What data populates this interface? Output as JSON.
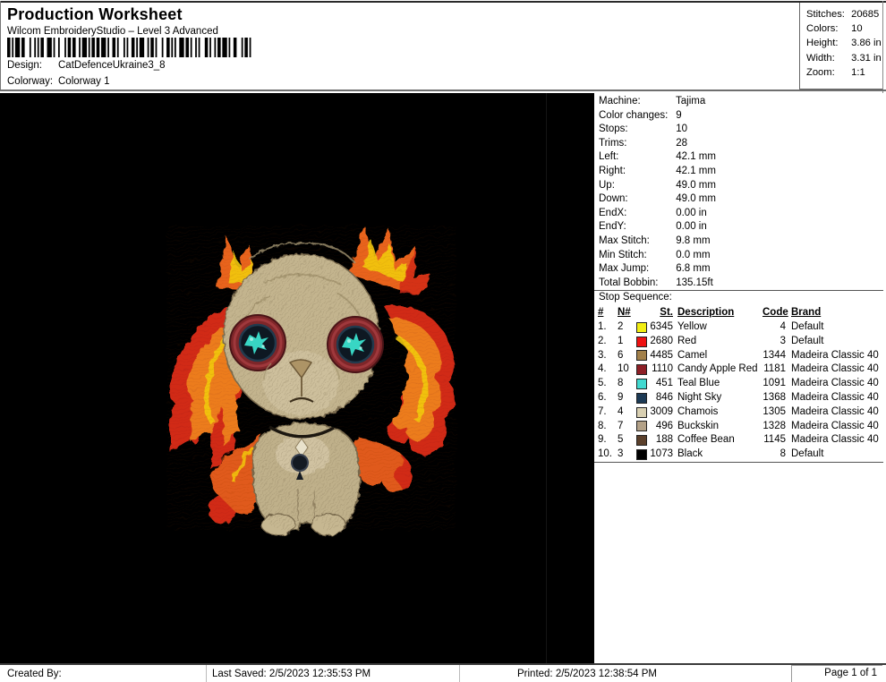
{
  "header": {
    "title": "Production Worksheet",
    "subtitle": "Wilcom EmbroideryStudio – Level 3 Advanced",
    "design_label": "Design:",
    "design_value": "CatDefenceUkraine3_8",
    "colorway_label": "Colorway:",
    "colorway_value": "Colorway 1"
  },
  "summary": {
    "rows": [
      {
        "label": "Stitches:",
        "value": "20685"
      },
      {
        "label": "Colors:",
        "value": "10"
      },
      {
        "label": "Height:",
        "value": "3.86 in"
      },
      {
        "label": "Width:",
        "value": "3.31 in"
      },
      {
        "label": "Zoom:",
        "value": "1:1"
      }
    ]
  },
  "machine_info": {
    "rows": [
      {
        "label": "Machine:",
        "value": "Tajima"
      },
      {
        "label": "Color changes:",
        "value": "9"
      },
      {
        "label": "Stops:",
        "value": "10"
      },
      {
        "label": "Trims:",
        "value": "28"
      },
      {
        "label": "Left:",
        "value": "42.1 mm"
      },
      {
        "label": "Right:",
        "value": "42.1 mm"
      },
      {
        "label": "Up:",
        "value": "49.0 mm"
      },
      {
        "label": "Down:",
        "value": "49.0 mm"
      },
      {
        "label": "EndX:",
        "value": "0.00 in"
      },
      {
        "label": "EndY:",
        "value": "0.00 in"
      },
      {
        "label": "Max Stitch:",
        "value": "9.8 mm"
      },
      {
        "label": "Min Stitch:",
        "value": "0.0 mm"
      },
      {
        "label": "Max Jump:",
        "value": "6.8 mm"
      },
      {
        "label": "Total Bobbin:",
        "value": "135.15ft"
      }
    ]
  },
  "stop_sequence": {
    "section_label": "Stop Sequence:",
    "columns": [
      "#",
      "N#",
      "St.",
      "Description",
      "Code",
      "Brand"
    ],
    "rows": [
      {
        "num": "1.",
        "n": "2",
        "swatch": "#f2ee12",
        "st": "6345",
        "description": "Yellow",
        "code": "4",
        "brand": "Default"
      },
      {
        "num": "2.",
        "n": "1",
        "swatch": "#ee1111",
        "st": "2680",
        "description": "Red",
        "code": "3",
        "brand": "Default"
      },
      {
        "num": "3.",
        "n": "6",
        "swatch": "#a28049",
        "st": "4485",
        "description": "Camel",
        "code": "1344",
        "brand": "Madeira Classic 40"
      },
      {
        "num": "4.",
        "n": "10",
        "swatch": "#8e1f26",
        "st": "1110",
        "description": "Candy Apple Red",
        "code": "1181",
        "brand": "Madeira Classic 40"
      },
      {
        "num": "5.",
        "n": "8",
        "swatch": "#41d9d0",
        "st": "451",
        "description": "Teal Blue",
        "code": "1091",
        "brand": "Madeira Classic 40"
      },
      {
        "num": "6.",
        "n": "9",
        "swatch": "#1c3a55",
        "st": "846",
        "description": "Night Sky",
        "code": "1368",
        "brand": "Madeira Classic 40"
      },
      {
        "num": "7.",
        "n": "4",
        "swatch": "#d9d0b2",
        "st": "3009",
        "description": "Chamois",
        "code": "1305",
        "brand": "Madeira Classic 40"
      },
      {
        "num": "8.",
        "n": "7",
        "swatch": "#b3a187",
        "st": "496",
        "description": "Buckskin",
        "code": "1328",
        "brand": "Madeira Classic 40"
      },
      {
        "num": "9.",
        "n": "5",
        "swatch": "#5b402b",
        "st": "188",
        "description": "Coffee Bean",
        "code": "1145",
        "brand": "Madeira Classic 40"
      },
      {
        "num": "10.",
        "n": "3",
        "swatch": "#000000",
        "st": "1073",
        "description": "Black",
        "code": "8",
        "brand": "Default"
      }
    ]
  },
  "design_preview": {
    "subject": "fluffy-cat-doll-with-button-eyes-and-flames",
    "background": "#000000",
    "palette": [
      "#f2c90f",
      "#ec7c1e",
      "#d12a18",
      "#c3b48e",
      "#8a2b2e",
      "#142030",
      "#38d6c4",
      "#5b402b"
    ]
  },
  "footer": {
    "created_by": "Created By:",
    "last_saved": "Last Saved: 2/5/2023 12:35:53 PM",
    "printed": "Printed: 2/5/2023 12:38:54 PM",
    "page": "Page 1 of 1"
  }
}
